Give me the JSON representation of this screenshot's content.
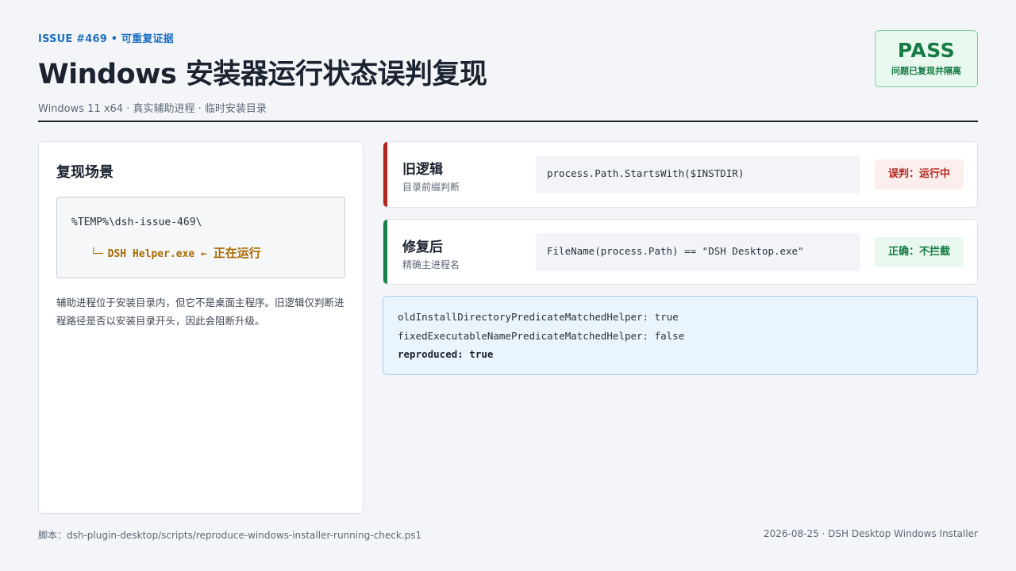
{
  "header": {
    "issue_tag": "ISSUE #469 • 可重复证据",
    "title": "Windows 安装器运行状态误判复现",
    "subtitle": "Windows 11 x64 · 真实辅助进程 · 临时安装目录"
  },
  "status": {
    "result": "PASS",
    "note": "问题已复现并隔离"
  },
  "scenario": {
    "title": "复现场景",
    "path": "%TEMP%\\dsh-issue-469\\",
    "child_branch": "└─",
    "child_process": "DSH Helper.exe ←",
    "child_state": "正在运行",
    "description": "辅助进程位于安装目录内，但它不是桌面主程序。旧逻辑仅判断进程路径是否以安装目录开头，因此会阻断升级。"
  },
  "comparisons": [
    {
      "label": "旧逻辑",
      "sub": "目录前缀判断",
      "code": "process.Path.StartsWith($INSTDIR)",
      "verdict": "误判：运行中",
      "color": "#b3261e"
    },
    {
      "label": "修复后",
      "sub": "精确主进程名",
      "code": "FileName(process.Path) == \"DSH Desktop.exe\"",
      "verdict": "正确：不拦截",
      "color": "#17804a"
    }
  ],
  "results": {
    "line1": "oldInstallDirectoryPredicateMatchedHelper: true",
    "line2": "fixedExecutableNamePredicateMatchedHelper: false",
    "line3": "reproduced: true"
  },
  "footer": {
    "script": "脚本：dsh-plugin-desktop/scripts/reproduce-windows-installer-running-check.ps1",
    "meta": "2026-08-25 · DSH Desktop Windows Installer"
  }
}
